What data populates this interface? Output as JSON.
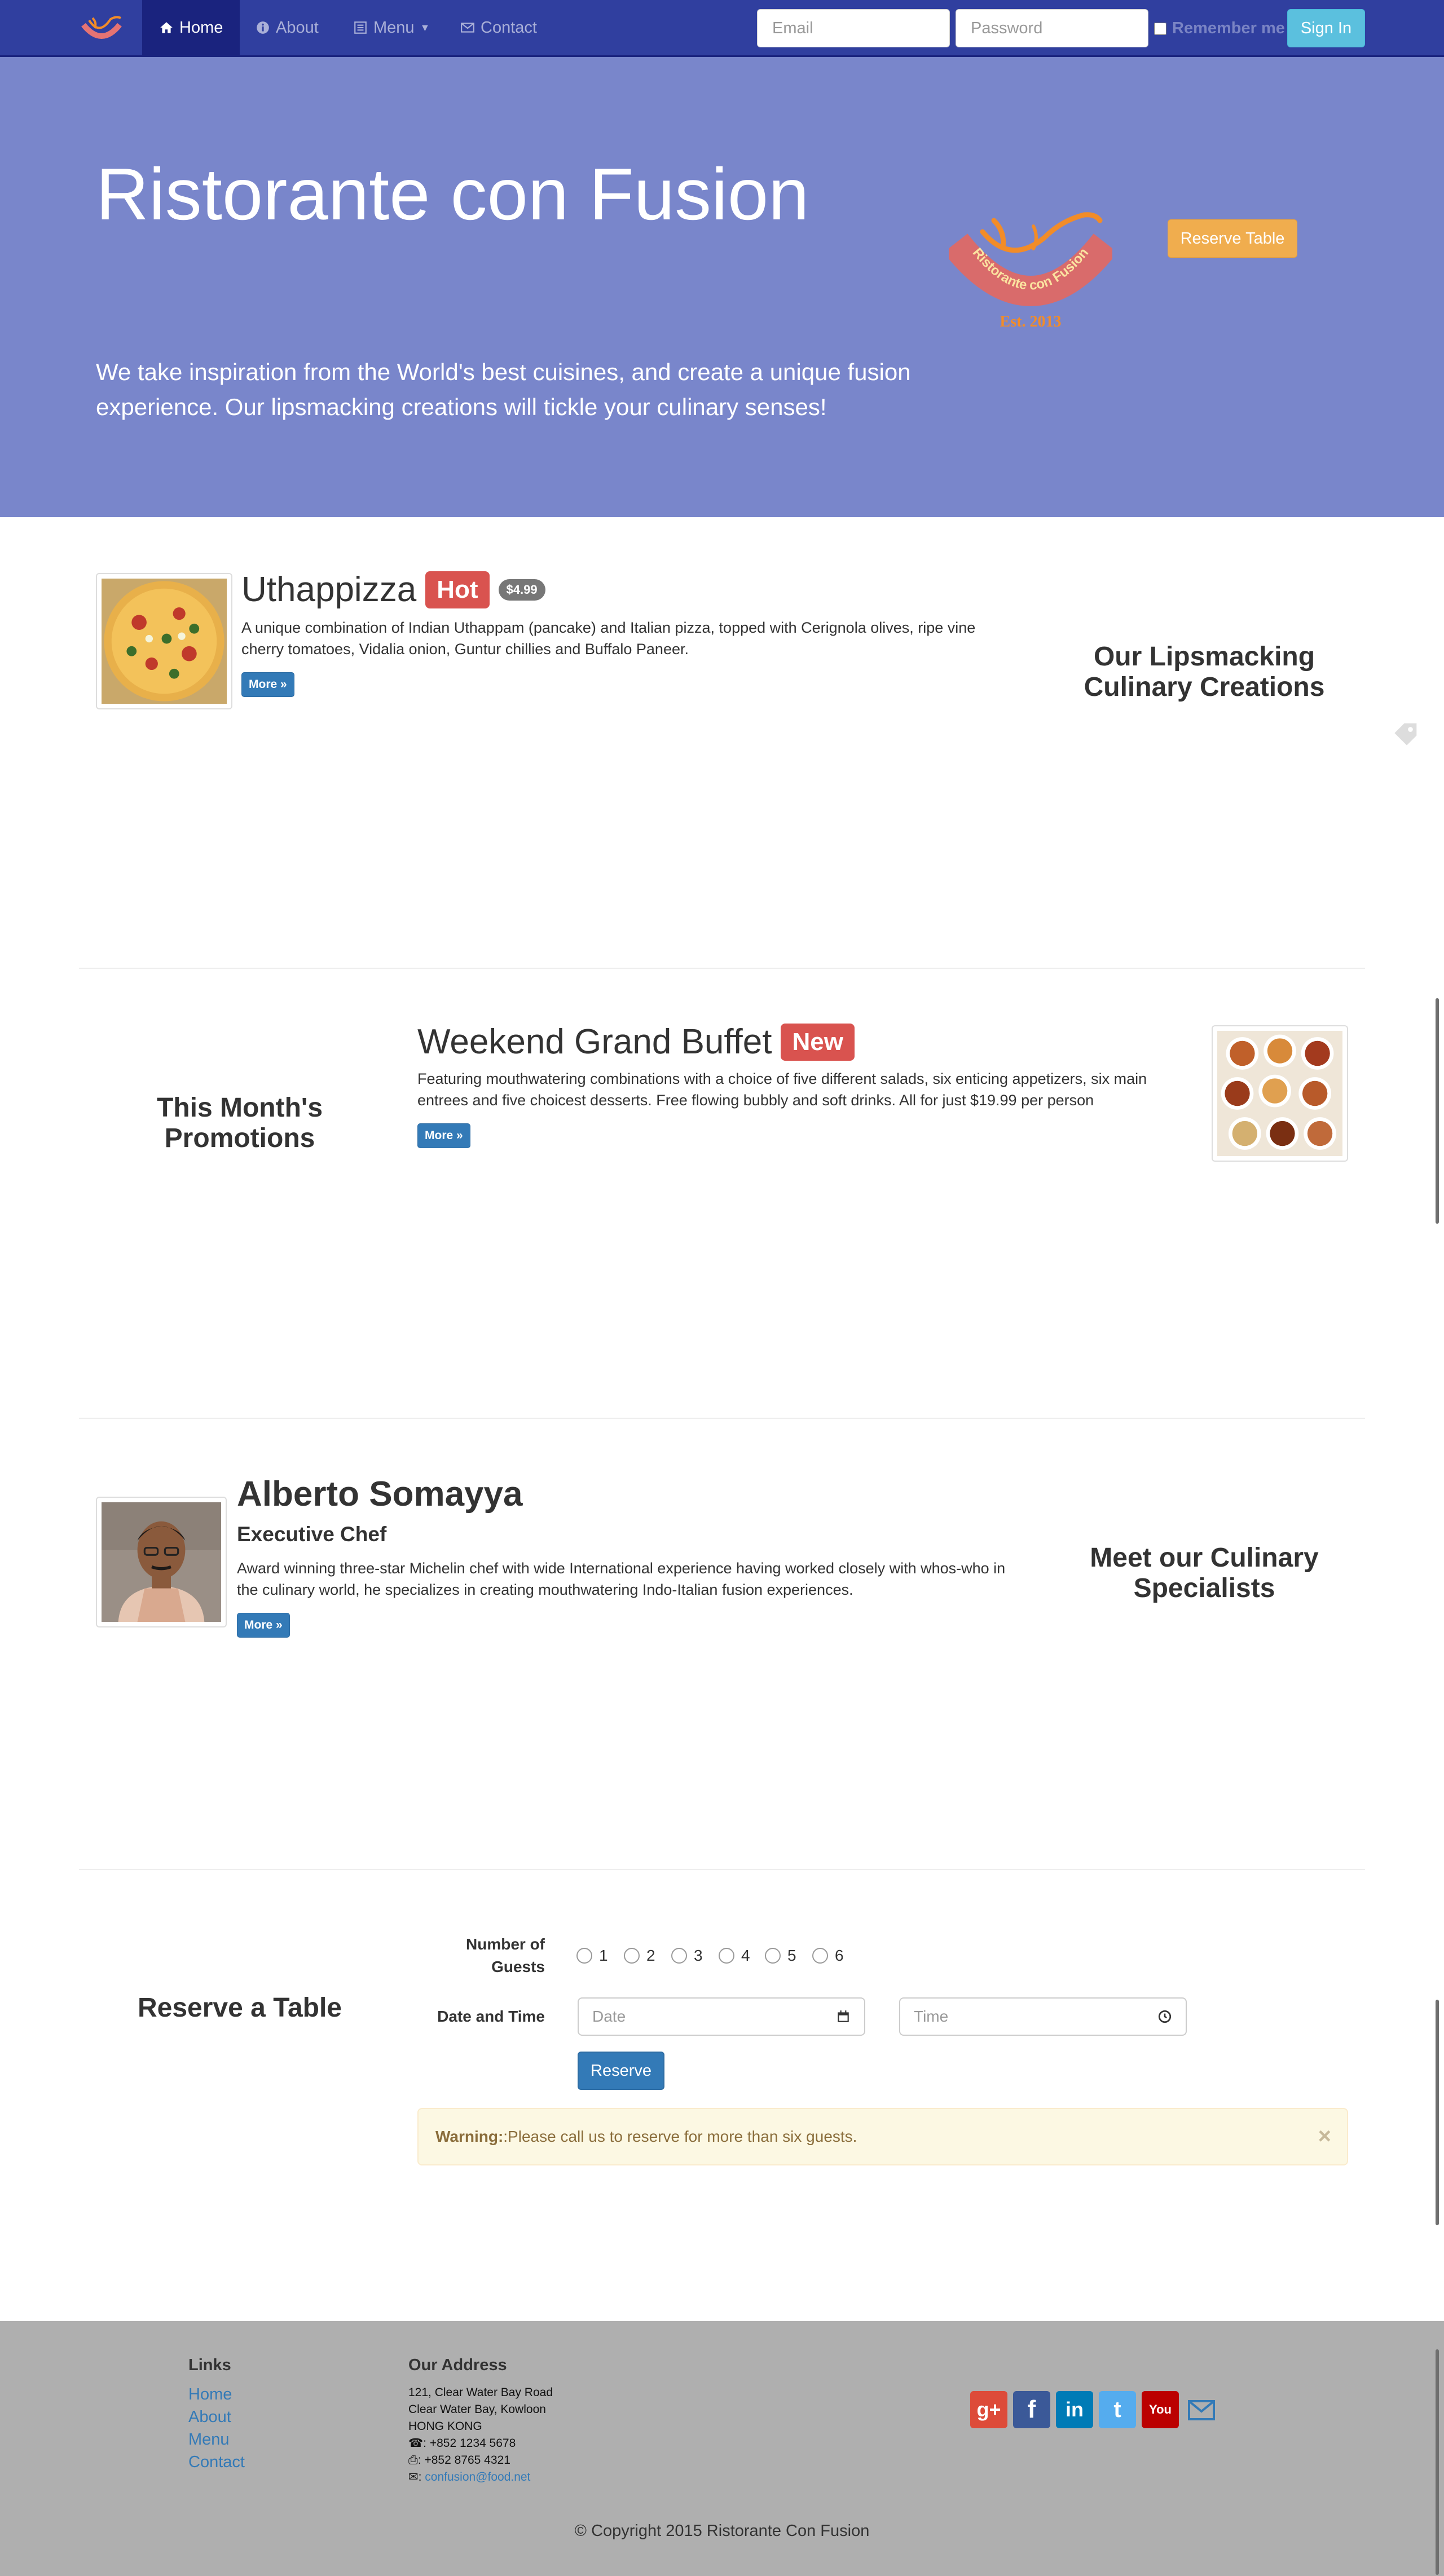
{
  "nav": {
    "items": [
      {
        "label": "Home",
        "icon": "home-icon"
      },
      {
        "label": "About",
        "icon": "info-circle-icon"
      },
      {
        "label": "Menu",
        "icon": "list-icon"
      },
      {
        "label": "Contact",
        "icon": "envelope-icon"
      }
    ],
    "email_placeholder": "Email",
    "password_placeholder": "Password",
    "remember_label": "Remember me",
    "signin_label": "Sign In"
  },
  "jumbotron": {
    "title": "Ristorante con Fusion",
    "text": "We take inspiration from the World's best cuisines, and create a unique fusion experience. Our lipsmacking creations will tickle your culinary senses!",
    "reserve_label": "Reserve Table",
    "logo_text": "Ristorante con Fusion",
    "logo_est": "Est. 2013"
  },
  "dish": {
    "name": "Uthappizza",
    "label": "Hot",
    "price": "$4.99",
    "description": "A unique combination of Indian Uthappam (pancake) and Italian pizza, topped with Cerignola olives, ripe vine cherry tomatoes, Vidalia onion, Guntur chillies and Buffalo Paneer.",
    "more_label": "More »",
    "heading": "Our Lipsmacking Culinary Creations"
  },
  "promotion": {
    "heading": "This Month's Promotions",
    "name": "Weekend Grand Buffet",
    "label": "New",
    "description": "Featuring mouthwatering combinations with a choice of five different salads, six enticing appetizers, six main entrees and five choicest desserts. Free flowing bubbly and soft drinks. All for just $19.99 per person",
    "more_label": "More »"
  },
  "leader": {
    "name": "Alberto Somayya",
    "designation": "Executive Chef",
    "description": "Award winning three-star Michelin chef with wide International experience having worked closely with whos-who in the culinary world, he specializes in creating mouthwatering Indo-Italian fusion experiences.",
    "more_label": "More »",
    "heading": "Meet our Culinary Specialists"
  },
  "reserve": {
    "heading": "Reserve a Table",
    "guests_label": "Number of Guests",
    "guest_options": [
      "1",
      "2",
      "3",
      "4",
      "5",
      "6"
    ],
    "datetime_label": "Date and Time",
    "date_placeholder": "Date",
    "time_placeholder": "Time",
    "submit_label": "Reserve",
    "warning_strong": "Warning:",
    "warning_text": ":Please call us to reserve for more than six guests.",
    "close_label": "×"
  },
  "footer": {
    "links_heading": "Links",
    "links": [
      "Home",
      "About",
      "Menu",
      "Contact"
    ],
    "address_heading": "Our Address",
    "address_lines": [
      "121, Clear Water Bay Road",
      "Clear Water Bay, Kowloon",
      "HONG KONG"
    ],
    "phone": ": +852 1234 5678",
    "fax": ": +852 8765 4321",
    "email": "confusion@food.net",
    "social": [
      {
        "name": "google-plus-icon",
        "glyph": "g+",
        "color": "#dd4b39"
      },
      {
        "name": "facebook-icon",
        "glyph": "f",
        "color": "#3b5998"
      },
      {
        "name": "linkedin-icon",
        "glyph": "in",
        "color": "#007bb6"
      },
      {
        "name": "twitter-icon",
        "glyph": "t",
        "color": "#55acee"
      },
      {
        "name": "youtube-icon",
        "glyph": "You",
        "color": "#bb0000"
      }
    ],
    "copyright": "© Copyright 2015 Ristorante Con Fusion"
  },
  "colors": {
    "navbar": "#303f9f",
    "navbar_active": "#1a237e",
    "jumbotron": "#7986cb",
    "primary": "#337ab7",
    "warning_button": "#f0ad4e",
    "danger_label": "#d9534f",
    "footer": "#afafaf"
  }
}
